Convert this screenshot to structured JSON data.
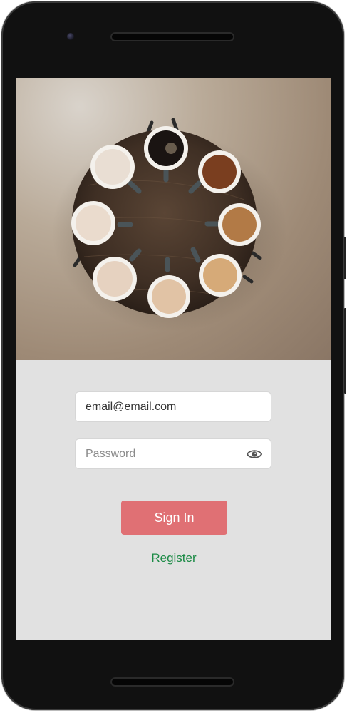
{
  "login": {
    "email_value": "email@email.com",
    "password_placeholder": "Password",
    "password_toggle_icon": "eye-icon",
    "signin_label": "Sign In",
    "register_label": "Register"
  },
  "hero": {
    "image_subject": "coffee cups arranged in a circle on a round wooden table"
  },
  "colors": {
    "signin_button": "#e07074",
    "register_link": "#1b8a45",
    "form_background": "#e1e1e1"
  }
}
